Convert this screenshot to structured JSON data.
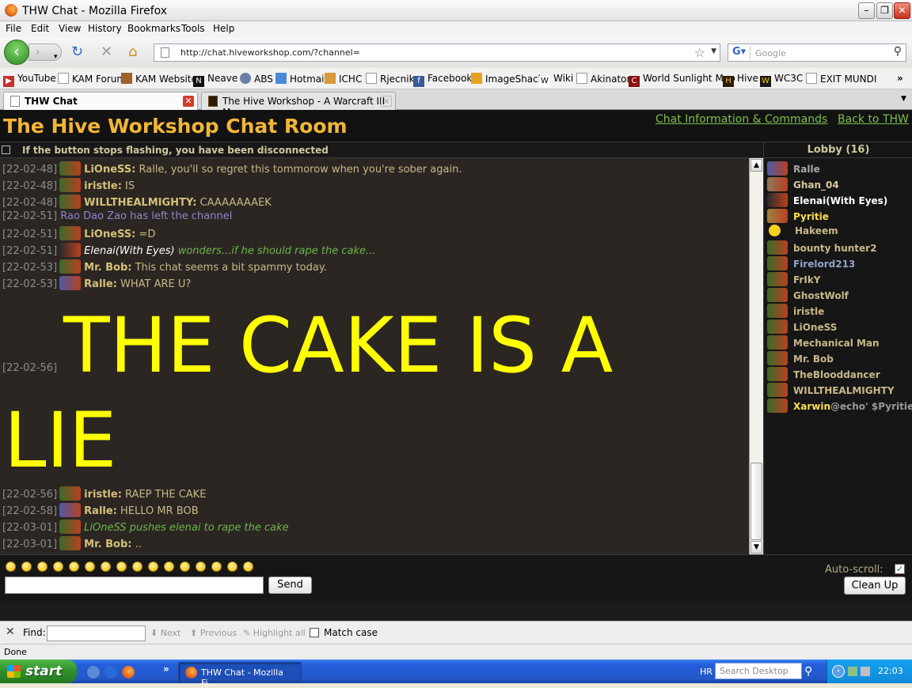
{
  "window": {
    "title": "THW Chat - Mozilla Firefox"
  },
  "menu": [
    "File",
    "Edit",
    "View",
    "History",
    "Bookmarks",
    "Tools",
    "Help"
  ],
  "nav": {
    "url": "http://chat.hiveworkshop.com/?channel=",
    "search_placeholder": "Google"
  },
  "bookmarks": [
    "YouTube",
    "KAM Forum",
    "KAM Website",
    "Neave",
    "ABS",
    "Hotmail",
    "ICHC",
    "Rjecnik",
    "Facebook",
    "ImageShack",
    "Wiki",
    "Akinator",
    "World Sunlight Map",
    "Hive",
    "WC3C",
    "EXIT MUNDI"
  ],
  "tabs": [
    {
      "label": "THW Chat"
    },
    {
      "label": "The Hive Workshop - A Warcraft III Mo..."
    }
  ],
  "page": {
    "title": "The Hive Workshop Chat Room",
    "link_info": "Chat Information & Commands",
    "link_back": "Back to THW",
    "notice": "If the button stops flashing, you have been disconnected"
  },
  "messages": [
    {
      "time": "[22-02-48]",
      "nick": "LiOneSS:",
      "text": "Ralle, you'll so regret this tommorow when you're sober again."
    },
    {
      "time": "[22-02-48]",
      "nick": "iristle:",
      "text": "IS"
    },
    {
      "time": "[22-02-48]",
      "nick": "WILLTHEALMIGHTY:",
      "text": "CAAAAAAAEK"
    },
    {
      "time": "[22-02-51]",
      "system": "Rao Dao Zao has left the channel"
    },
    {
      "time": "[22-02-51]",
      "nick": "LiOneSS:",
      "text": "=D"
    },
    {
      "time": "[22-02-51]",
      "emote_nick": "Elenai(With Eyes)",
      "emote": "wonders...if he should rape the cake..."
    },
    {
      "time": "[22-02-53]",
      "nick": "Mr. Bob:",
      "text": "This chat seems a bit spammy today."
    },
    {
      "time": "[22-02-53]",
      "nick": "Ralle:",
      "text": "WHAT ARE U?"
    }
  ],
  "big_message": {
    "time": "[22-02-56]",
    "line1": "THE CAKE IS A",
    "line2": "LIE"
  },
  "messages2": [
    {
      "time": "[22-02-56]",
      "nick": "iristle:",
      "text": "RAEP THE CAKE"
    },
    {
      "time": "[22-02-58]",
      "nick": "Ralle:",
      "text": "HELLO MR BOB"
    },
    {
      "time": "[22-03-01]",
      "emote": "LiOneSS pushes elenai to rape the cake"
    },
    {
      "time": "[22-03-01]",
      "nick": "Mr. Bob:",
      "text": ".."
    }
  ],
  "userlist": {
    "header": "Lobby (16)",
    "users": [
      {
        "name": "Ralle",
        "color": "#a8a8a8"
      },
      {
        "name": "Ghan_04",
        "color": "#d8c89a"
      },
      {
        "name": "Elenai(With Eyes)",
        "color": "#ffffff"
      },
      {
        "name": "Pyritie",
        "color": "#ffe04a"
      },
      {
        "name": "Hakeem",
        "color": "#c8b888"
      },
      {
        "name": "bounty hunter2",
        "color": "#c8b888"
      },
      {
        "name": "Firelord213",
        "color": "#8fa4c8"
      },
      {
        "name": "FrIkY",
        "color": "#c8b888"
      },
      {
        "name": "GhostWolf",
        "color": "#c8b888"
      },
      {
        "name": "iristle",
        "color": "#c8b888"
      },
      {
        "name": "LiOneSS",
        "color": "#c8b888"
      },
      {
        "name": "Mechanical Man",
        "color": "#c8b888"
      },
      {
        "name": "Mr. Bob",
        "color": "#c8b888"
      },
      {
        "name": "TheBlooddancer",
        "color": "#c8b888"
      },
      {
        "name": "WILLTHEALMIGHTY",
        "color": "#c8b888"
      },
      {
        "name": "Xarwin",
        "color": "#ffe04a",
        "suffix": "@echo' $Pyritie'"
      }
    ]
  },
  "controls": {
    "send": "Send",
    "autoscroll": "Auto-scroll:",
    "cleanup": "Clean Up"
  },
  "findbar": {
    "label": "Find:",
    "next": "Next",
    "previous": "Previous",
    "highlight": "Highlight all",
    "matchcase": "Match case"
  },
  "status": "Done",
  "taskbar": {
    "start": "start",
    "item": "THW Chat - Mozilla Fi...",
    "lang": "HR",
    "desktop_search": "Search Desktop",
    "clock": "22:03"
  }
}
